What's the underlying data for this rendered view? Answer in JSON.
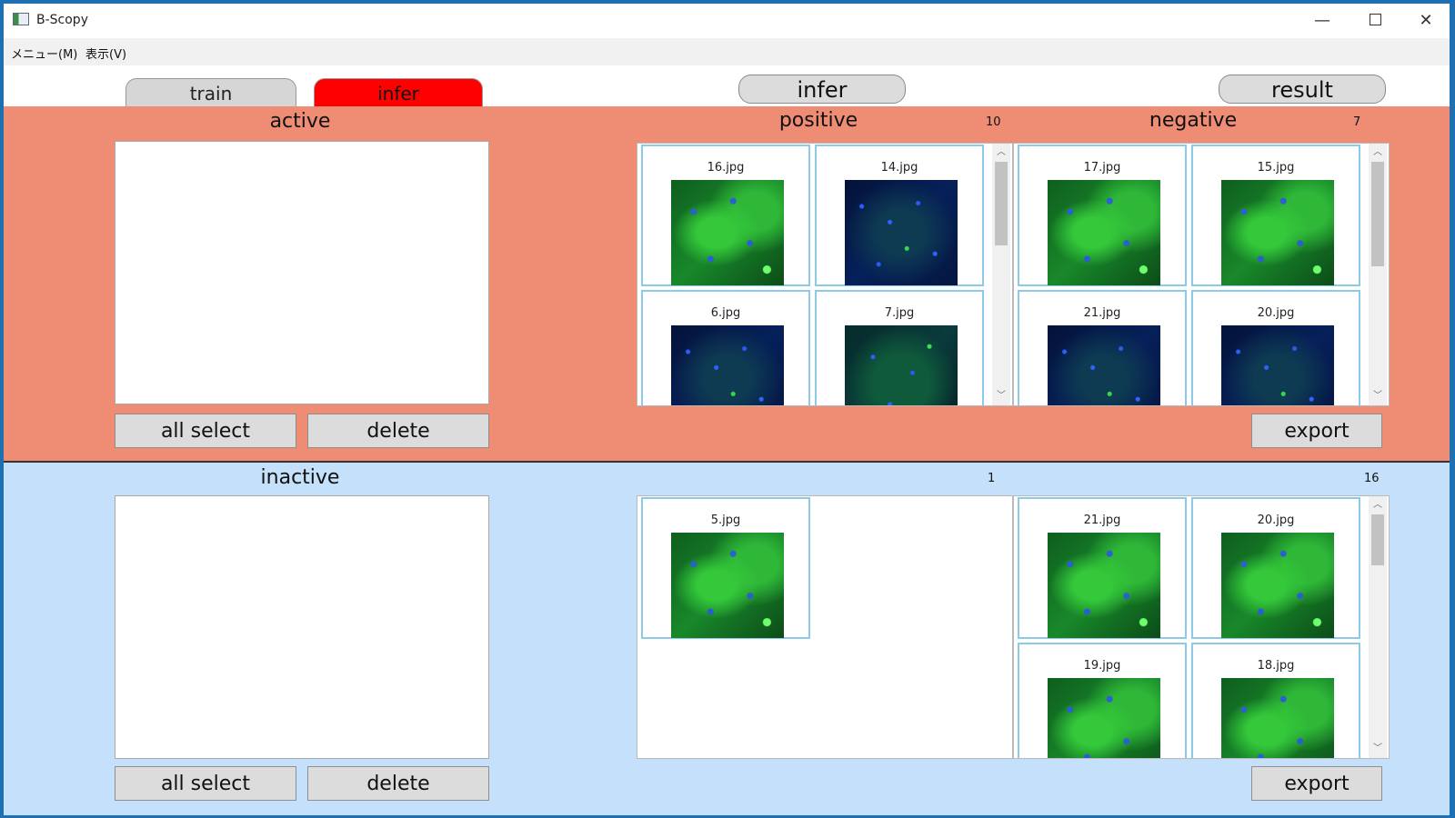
{
  "window": {
    "title": "B-Scopy",
    "controls": {
      "minimize": "—",
      "close": "✕"
    }
  },
  "menu": [
    {
      "label": "メニュー(M)"
    },
    {
      "label": "表示(V)"
    }
  ],
  "tabs": {
    "train": "train",
    "infer": "infer",
    "selected": "infer"
  },
  "toolbar": {
    "infer_button": "infer",
    "result_button": "result"
  },
  "active_panel": {
    "heading": "active",
    "buttons": {
      "all_select": "all select",
      "delete": "delete",
      "export": "export"
    },
    "positive": {
      "heading": "positive",
      "count": "10",
      "images": [
        {
          "name": "16.jpg",
          "style": "green"
        },
        {
          "name": "14.jpg",
          "style": "blue"
        },
        {
          "name": "6.jpg",
          "style": "blue"
        },
        {
          "name": "7.jpg",
          "style": "mixed"
        }
      ]
    },
    "negative": {
      "heading": "negative",
      "count": "7",
      "images": [
        {
          "name": "17.jpg",
          "style": "green"
        },
        {
          "name": "15.jpg",
          "style": "green"
        },
        {
          "name": "21.jpg",
          "style": "blue"
        },
        {
          "name": "20.jpg",
          "style": "blue"
        }
      ]
    }
  },
  "inactive_panel": {
    "heading": "inactive",
    "buttons": {
      "all_select": "all select",
      "delete": "delete",
      "export": "export"
    },
    "positive": {
      "count": "1",
      "images": [
        {
          "name": "5.jpg",
          "style": "green"
        }
      ]
    },
    "negative": {
      "count": "16",
      "images": [
        {
          "name": "21.jpg",
          "style": "green"
        },
        {
          "name": "20.jpg",
          "style": "green"
        },
        {
          "name": "19.jpg",
          "style": "green"
        },
        {
          "name": "18.jpg",
          "style": "green"
        }
      ]
    }
  },
  "colors": {
    "active_bg": "#ee8c74",
    "inactive_bg": "#c4e0fa",
    "selected_tab": "#ff0000",
    "thumb_border": "#8ccbe8"
  }
}
